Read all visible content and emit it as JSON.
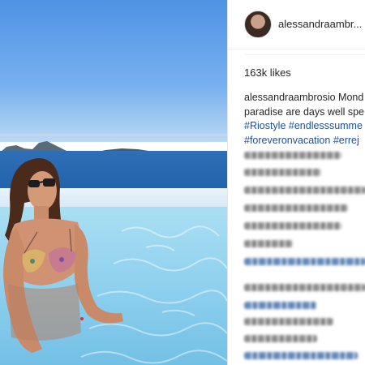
{
  "post": {
    "username": "alessandraambr...",
    "likes": "163k likes",
    "caption_user": "alessandraambrosio",
    "caption_line1_rest": " Mond",
    "caption_line2": "paradise are days well spe",
    "hashtags_line3a": "#Riostyle",
    "hashtags_line3b": "#endlesssumme",
    "hashtags_line4a": "#foreveronvacation",
    "hashtags_line4b": "#errej"
  },
  "colors": {
    "hashtag": "#1f4f8f",
    "text": "#262626"
  },
  "icons": {
    "avatar": "profile-avatar"
  }
}
